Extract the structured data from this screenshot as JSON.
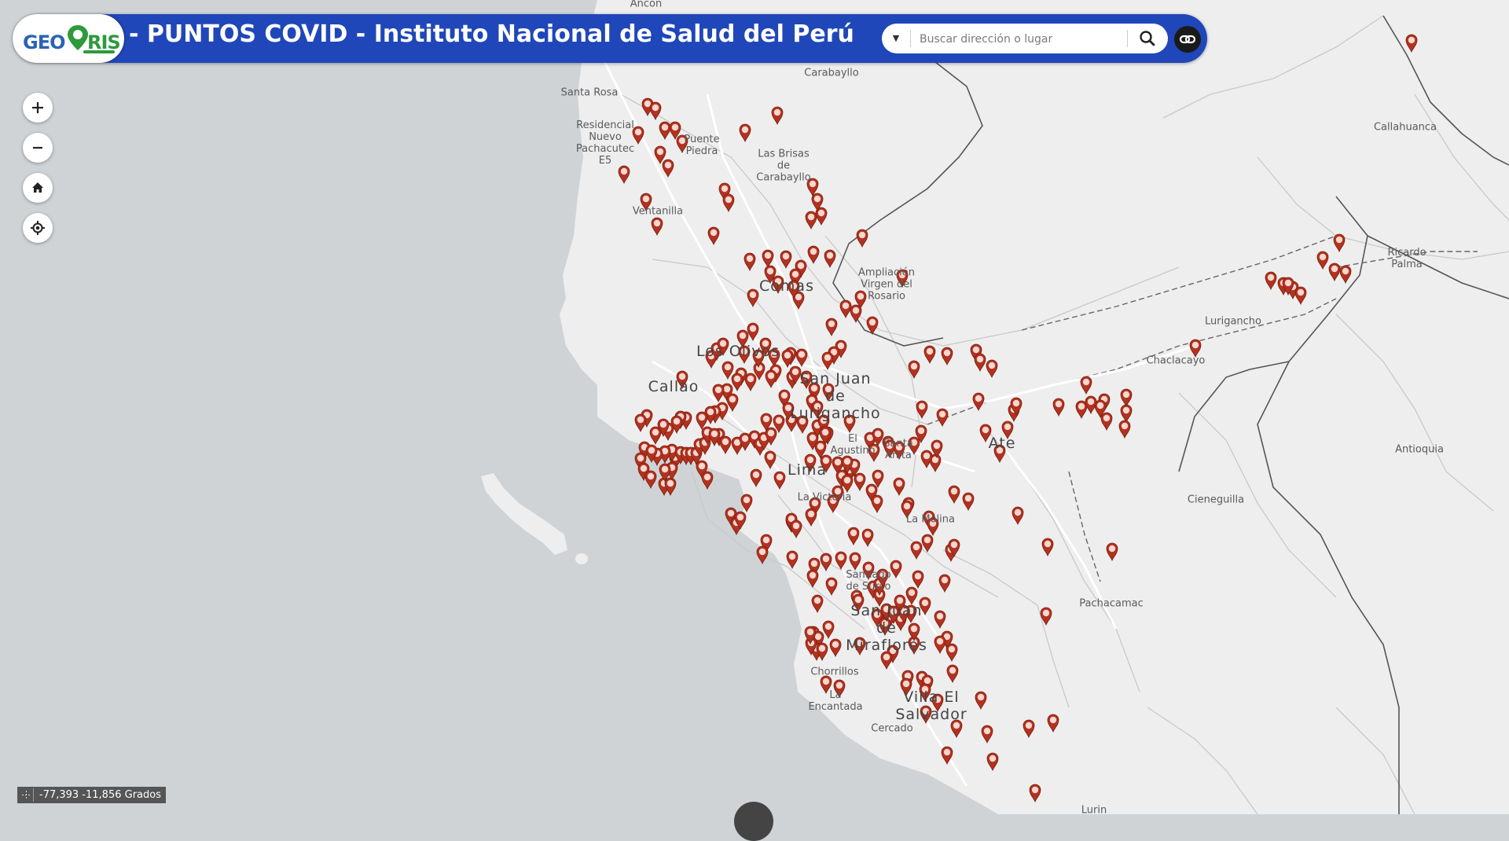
{
  "header": {
    "logo_text_geo": "GEO",
    "logo_text_ris": "RIS",
    "title": "- PUNTOS COVID - Instituto Nacional de Salud del Perú"
  },
  "search": {
    "placeholder": "Buscar dirección o lugar"
  },
  "controls": [
    "plus-icon",
    "minus-icon",
    "home-icon",
    "locate-icon",
    "link-icon",
    "search-icon"
  ],
  "coordinates": {
    "text": "-77,393 -11,856 Grados"
  },
  "map_labels": [
    {
      "name": "Ancon",
      "size": "s"
    },
    {
      "name": "Santa Rosa",
      "size": "s"
    },
    {
      "name": "Carabayllo",
      "size": "s"
    },
    {
      "name": "Residencial\nNuevo\nPachacutec\nE5",
      "size": "s"
    },
    {
      "name": "Puente\nPiedra",
      "size": "s"
    },
    {
      "name": "Las Brisas\nde\nCarabayllo",
      "size": "s"
    },
    {
      "name": "Ventanilla",
      "size": "s"
    },
    {
      "name": "Comas",
      "size": "l"
    },
    {
      "name": "Ampliación\nVirgen del\nRosario",
      "size": "s"
    },
    {
      "name": "Los Olivos",
      "size": "l"
    },
    {
      "name": "San Juan\nde\nLurigancho",
      "size": "l"
    },
    {
      "name": "Callao",
      "size": "l"
    },
    {
      "name": "El\nAgustino",
      "size": "s"
    },
    {
      "name": "Santa\nAnita",
      "size": "s"
    },
    {
      "name": "Ate",
      "size": "l"
    },
    {
      "name": "Lima",
      "size": "l"
    },
    {
      "name": "La Victoria",
      "size": "s"
    },
    {
      "name": "La Molina",
      "size": "s"
    },
    {
      "name": "Santiago\nde Surco",
      "size": "s"
    },
    {
      "name": "San Juan\nde\nMiraflores",
      "size": "l"
    },
    {
      "name": "Chorrillos",
      "size": "s"
    },
    {
      "name": "La\nEncantada",
      "size": "s"
    },
    {
      "name": "Villa El\nSalvador",
      "size": "l"
    },
    {
      "name": "Cercado",
      "size": "s"
    },
    {
      "name": "Lurigancho",
      "size": "s"
    },
    {
      "name": "Chaclacayo",
      "size": "s"
    },
    {
      "name": "Callahuanca",
      "size": "s"
    },
    {
      "name": "Ricardo\nPalma",
      "size": "s"
    },
    {
      "name": "Antioquia",
      "size": "s"
    },
    {
      "name": "Cieneguilla",
      "size": "s"
    },
    {
      "name": "Pachacamac",
      "size": "s"
    },
    {
      "name": "Lurin",
      "size": "s"
    }
  ],
  "colors": {
    "header": "#2047b9",
    "marker": "#b3321f",
    "marker_center": "#f7d7cf",
    "land": "#eeeeee",
    "sea": "#cfd3d6"
  }
}
